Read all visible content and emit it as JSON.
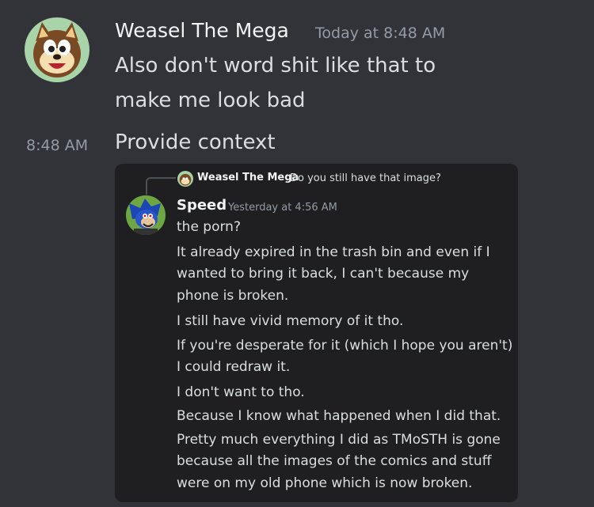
{
  "message": {
    "author": "Weasel The Mega",
    "timestamp": "Today at 8:48 AM",
    "lines": [
      "Also don't word shit like that to",
      "make me look bad"
    ]
  },
  "followup": {
    "timestamp": "8:48 AM",
    "text": "Provide context"
  },
  "attachment": {
    "reply": {
      "author": "Weasel The Mega",
      "text": "Do you still have that image?"
    },
    "author": "Speed",
    "timestamp": "Yesterday at 4:56 AM",
    "lines": [
      "the porn?",
      "It already expired in the trash bin and even if I",
      "wanted to bring it back, I can't because my",
      "phone is broken.",
      "I still have vivid memory of it tho.",
      "If you're desperate for it (which I hope you aren't)",
      "I could redraw it.",
      "I don't want to tho.",
      "Because I know what happened when I did that.",
      "Pretty much everything I did as TMoSTH is gone",
      "because all the images of the comics and stuff",
      "were on my old phone which is now broken."
    ]
  },
  "colors": {
    "background": "#313338",
    "embed_background": "#1f1f22",
    "username": "#f2f3f5",
    "text": "#dbdee1",
    "muted": "#949ba4"
  },
  "icons": {
    "weasel_avatar": "weasel-avatar-icon",
    "speed_avatar": "speed-avatar-icon"
  }
}
